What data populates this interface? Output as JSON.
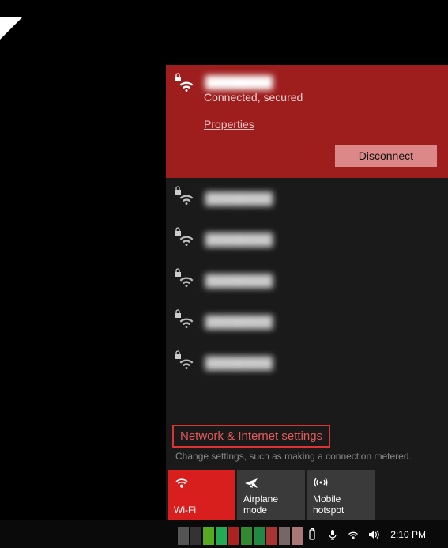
{
  "current_network": {
    "name": "████████",
    "status": "Connected, secured",
    "properties_label": "Properties",
    "disconnect_label": "Disconnect"
  },
  "networks": [
    {
      "name": "████████",
      "secured": true
    },
    {
      "name": "████████",
      "secured": true
    },
    {
      "name": "████████",
      "secured": true
    },
    {
      "name": "████████",
      "secured": true
    },
    {
      "name": "████████",
      "secured": true
    }
  ],
  "settings": {
    "link_label": "Network & Internet settings",
    "subtext": "Change settings, such as making a connection metered."
  },
  "tiles": [
    {
      "id": "wifi",
      "label": "Wi-Fi",
      "active": true
    },
    {
      "id": "airplane",
      "label": "Airplane mode",
      "active": false
    },
    {
      "id": "hotspot",
      "label": "Mobile hotspot",
      "active": false
    }
  ],
  "taskbar": {
    "clock": "2:10 PM",
    "block_colors": [
      "#555",
      "#333",
      "#5a2",
      "#2a5",
      "#a22",
      "#383",
      "#284",
      "#a33",
      "#766",
      "#a77"
    ]
  }
}
